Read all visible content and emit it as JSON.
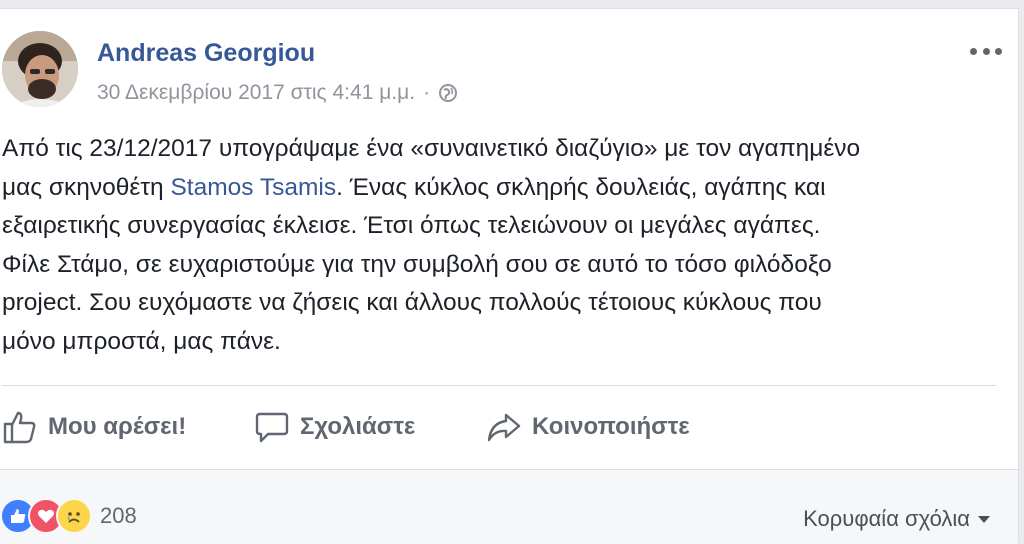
{
  "post": {
    "author": "Andreas Georgiou",
    "timestamp": "30 Δεκεμβρίου 2017 στις 4:41 μ.μ.",
    "separator": "·",
    "privacy_icon": "globe-icon",
    "more_icon": "more-options-icon",
    "body": {
      "line1": "Από τις 23/12/2017 υπογράψαμε ένα «συναινετικό διαζύγιο» με τον αγαπημένο",
      "line2_prefix": "μας σκηνοθέτη ",
      "line2_mention": "Stamos Tsamis",
      "line2_suffix": ". Ένας κύκλος σκληρής δουλειάς, αγάπης και",
      "line3": "εξαιρετικής συνεργασίας έκλεισε. Έτσι όπως τελειώνουν οι μεγάλες αγάπες.",
      "line4": "Φίλε Στάμο, σε ευχαριστούμε για την συμβολή σου σε αυτό το τόσο φιλόδοξο",
      "line5": "project. Σου ευχόμαστε να ζήσεις και άλλους πολλούς τέτοιους κύκλους που",
      "line6": "μόνο μπροστά, μας πάνε."
    }
  },
  "actions": {
    "like": {
      "label": "Μου αρέσει!",
      "icon": "thumbs-up-icon"
    },
    "comment": {
      "label": "Σχολιάστε",
      "icon": "comment-icon"
    },
    "share": {
      "label": "Κοινοποιήστε",
      "icon": "share-icon"
    }
  },
  "reactions": {
    "types": [
      "like",
      "love",
      "sad"
    ],
    "count": "208"
  },
  "comments": {
    "sort_label": "Κορυφαία σχόλια"
  },
  "colors": {
    "link": "#365899",
    "text": "#1d2129",
    "muted": "#90949c",
    "action": "#606770",
    "like": "#4080ff",
    "love": "#f25268",
    "sad": "#fcd54a"
  }
}
